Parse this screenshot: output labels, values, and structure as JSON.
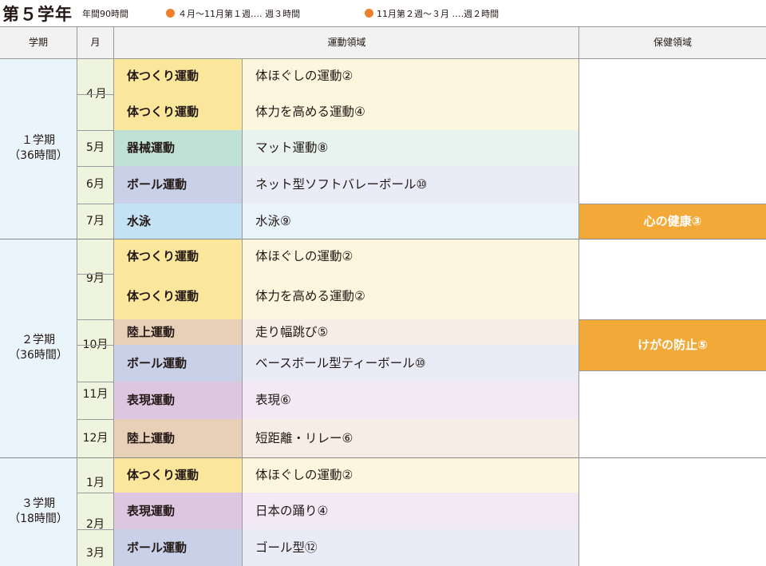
{
  "header": {
    "title": "第５学年",
    "annual_hours": "年間90時間",
    "note1": "４月〜11月第１週‥‥ 週３時間",
    "note2": "11月第２週〜３月 ‥‥週２時間",
    "note_color": "#ee7f2d"
  },
  "columns": {
    "term": "学期",
    "month": "月",
    "sports": "運動領域",
    "health": "保健領域"
  },
  "terms": [
    {
      "name": "１学期",
      "hours": "（36時間）"
    },
    {
      "name": "２学期",
      "hours": "（36時間）"
    },
    {
      "name": "３学期",
      "hours": "（18時間）"
    }
  ],
  "months": [
    "４月",
    "5月",
    "6月",
    "7月",
    "9月",
    "10月",
    "11月",
    "12月",
    "1月",
    "2月",
    "3月"
  ],
  "rows": [
    {
      "category": "体つくり運動",
      "detail": "体ほぐしの運動②",
      "cat_color": "#fae79c",
      "detail_color": "#fdf6df"
    },
    {
      "category": "体つくり運動",
      "detail": "体力を高める運動④",
      "cat_color": "#fae79c",
      "detail_color": "#fdf6df"
    },
    {
      "category": "器械運動",
      "detail": "マット運動⑧",
      "cat_color": "#bfe1d6",
      "detail_color": "#e8f3ef"
    },
    {
      "category": "ボール運動",
      "detail": "ネット型ソフトバレーボール⑩",
      "cat_color": "#c9d1e8",
      "detail_color": "#e9ecf7"
    },
    {
      "category": "水泳",
      "detail": "水泳⑨",
      "cat_color": "#c3e2f4",
      "detail_color": "#e8f3fa"
    },
    {
      "category": "体つくり運動",
      "detail": "体ほぐしの運動②",
      "cat_color": "#fae79c",
      "detail_color": "#fdf6df"
    },
    {
      "category": "体つくり運動",
      "detail": "体力を高める運動②",
      "cat_color": "#fae79c",
      "detail_color": "#fdf6df"
    },
    {
      "category": "陸上運動",
      "detail": "走り幅跳び⑤",
      "cat_color": "#e8cfb7",
      "detail_color": "#f6ede4"
    },
    {
      "category": "ボール運動",
      "detail": "ベースボール型ティーボール⑩",
      "cat_color": "#c9d1e8",
      "detail_color": "#e9ecf7"
    },
    {
      "category": "表現運動",
      "detail": "表現⑥",
      "cat_color": "#dcc6e0",
      "detail_color": "#f1e9f3"
    },
    {
      "category": "陸上運動",
      "detail": "短距離・リレー⑥",
      "cat_color": "#e8cfb7",
      "detail_color": "#f6ede4"
    },
    {
      "category": "体つくり運動",
      "detail": "体ほぐしの運動②",
      "cat_color": "#fae79c",
      "detail_color": "#fdf6df"
    },
    {
      "category": "表現運動",
      "detail": "日本の踊り④",
      "cat_color": "#dcc6e0",
      "detail_color": "#f1e9f3"
    },
    {
      "category": "ボール運動",
      "detail": "ゴール型⑫",
      "cat_color": "#c9d1e8",
      "detail_color": "#e9ecf7"
    }
  ],
  "health": [
    "心の健康③",
    "けがの防止⑤"
  ],
  "health_color": "#f3a937"
}
